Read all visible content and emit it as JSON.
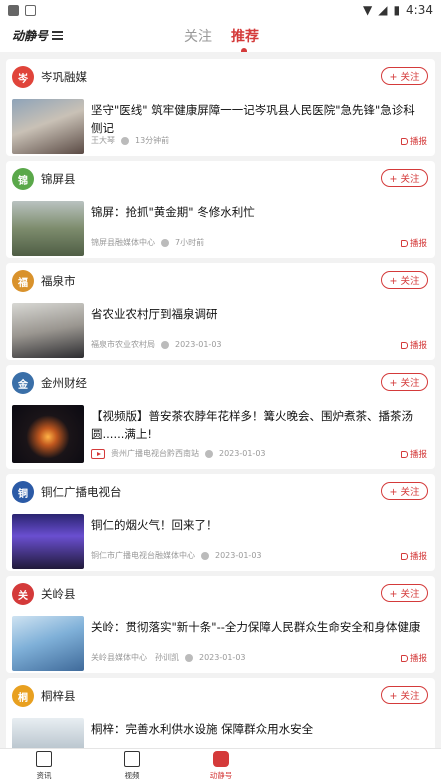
{
  "status_bar": {
    "time": "4:34"
  },
  "header": {
    "logo_text": "动静号",
    "tabs": [
      {
        "label": "关注",
        "active": false
      },
      {
        "label": "推荐",
        "active": true
      }
    ],
    "accent_color": "#d43a3a"
  },
  "follow_label": "+ 关注",
  "broadcast_label": "播报",
  "cards": [
    {
      "source": "岑巩融媒",
      "title": "坚守\"医线\" 筑牢健康屏障一一记岑巩县人民医院\"急先锋\"急诊科侧记",
      "author": "王大琴",
      "time": "13分钟前",
      "video": false
    },
    {
      "source": "锦屏县",
      "title": "锦屏：抢抓\"黄金期\" 冬修水利忙",
      "author": "锦屏县融媒体中心",
      "time": "7小时前",
      "video": false
    },
    {
      "source": "福泉市",
      "title": "省农业农村厅到福泉调研",
      "author": "福泉市农业农村局",
      "time": "2023-01-03",
      "video": false
    },
    {
      "source": "金州财经",
      "title": "【视频版】普安茶农脖年花样多！篝火晚会、围炉煮茶、播茶汤圆......满上!",
      "author": "贵州广播电视台黔西南站",
      "time": "2023-01-03",
      "video": true
    },
    {
      "source": "铜仁广播电视台",
      "title": "铜仁的烟火气！回来了！",
      "author": "铜仁市广播电视台融媒体中心",
      "time": "2023-01-03",
      "video": false
    },
    {
      "source": "关岭县",
      "title": "关岭：贯彻落实\"新十条\"--全力保障人民群众生命安全和身体健康",
      "author": "关岭县媒体中心　孙训凯",
      "time": "2023-01-03",
      "video": false
    },
    {
      "source": "桐梓县",
      "title": "桐梓：完善水利供水设施 保障群众用水安全",
      "author": "",
      "time": "",
      "video": false
    }
  ],
  "bottom_nav": [
    {
      "label": "资讯",
      "active": false
    },
    {
      "label": "视频",
      "active": false
    },
    {
      "label": "动静号",
      "active": true
    }
  ]
}
